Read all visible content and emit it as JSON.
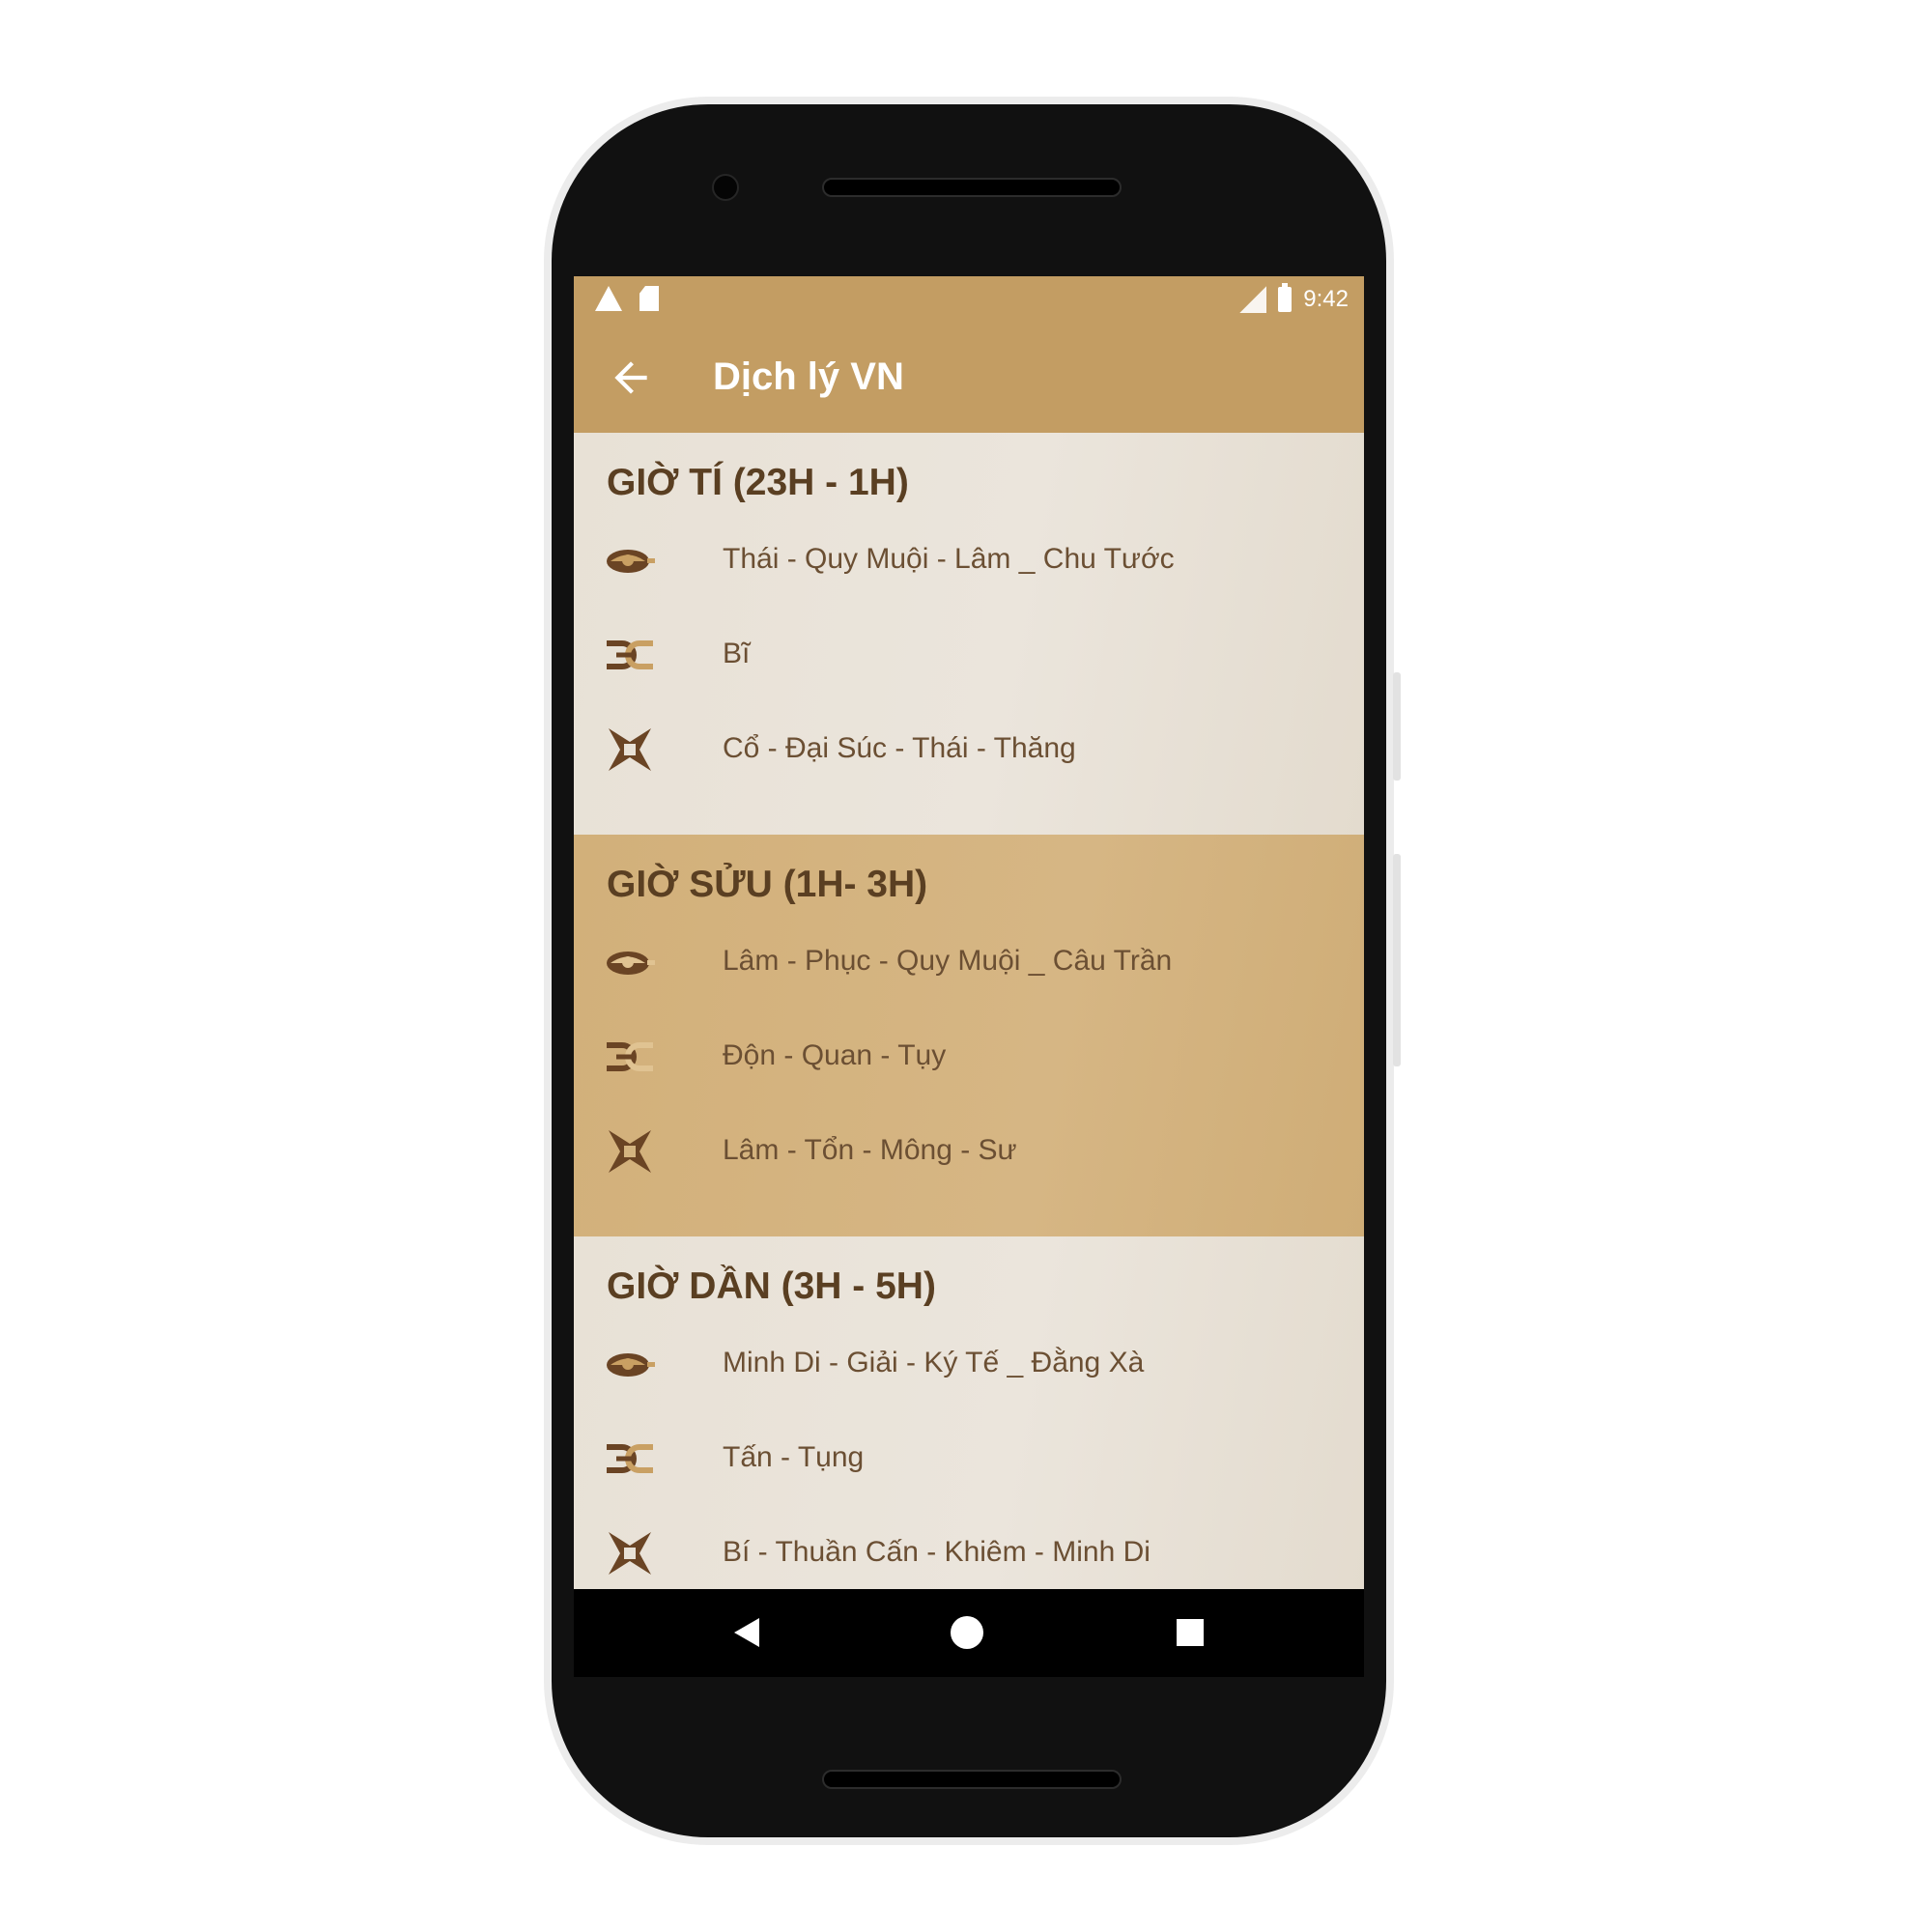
{
  "status_bar": {
    "time": "9:42",
    "left_icons": [
      "warning-icon",
      "sd-card-icon"
    ],
    "right_icons": [
      "signal-icon",
      "battery-icon"
    ]
  },
  "app_bar": {
    "title": "Dịch lý VN",
    "back_icon": "arrow-back-icon"
  },
  "sections": [
    {
      "title": "GIỜ TÍ (23H - 1H)",
      "rows": [
        {
          "icon": "eye-icon",
          "text": "Thái - Quy Muội - Lâm _ Chu Tước"
        },
        {
          "icon": "link-icon",
          "text": "Bĩ"
        },
        {
          "icon": "star-cross-icon",
          "text": "Cổ - Đại Súc - Thái - Thăng"
        }
      ]
    },
    {
      "title": "GIỜ SỬU (1H- 3H)",
      "rows": [
        {
          "icon": "eye-icon",
          "text": "Lâm - Phục - Quy Muội _ Câu Trần"
        },
        {
          "icon": "link-icon",
          "text": "Độn - Quan - Tụy"
        },
        {
          "icon": "star-cross-icon",
          "text": "Lâm - Tổn - Mông - Sư"
        }
      ]
    },
    {
      "title": "GIỜ DẦN (3H - 5H)",
      "rows": [
        {
          "icon": "eye-icon",
          "text": "Minh Di - Giải - Ký Tế _ Đằng Xà"
        },
        {
          "icon": "link-icon",
          "text": "Tấn - Tụng"
        },
        {
          "icon": "star-cross-icon",
          "text": "Bí - Thuần Cấn - Khiêm - Minh Di"
        }
      ]
    }
  ],
  "nav_bar": {
    "back": "nav-back-icon",
    "home": "nav-home-icon",
    "recent": "nav-recent-icon"
  },
  "colors": {
    "accent": "#c39d63",
    "section_dark": "#d2b07a",
    "section_light": "#e8e1d6",
    "title_text": "#5a3f22",
    "row_text": "#6b4f33",
    "icon_brown": "#6a4424",
    "icon_gold": "#c9a063"
  }
}
